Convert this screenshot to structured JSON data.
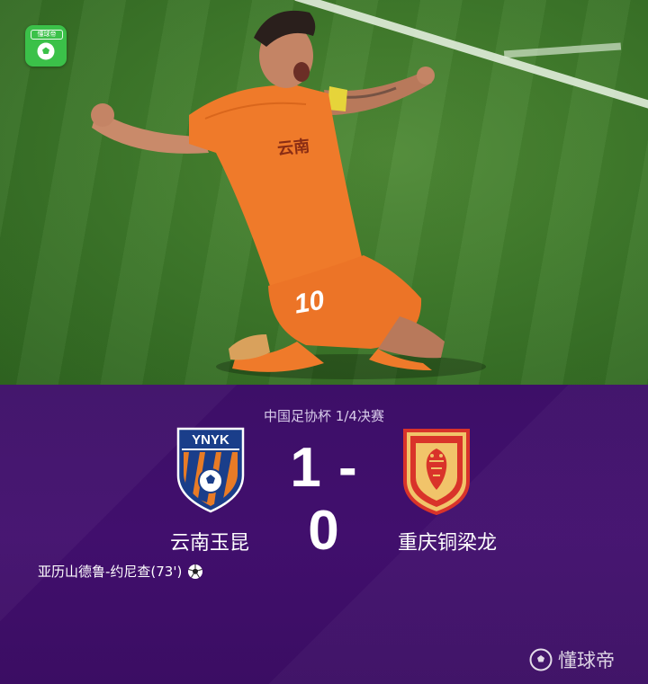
{
  "app_badge": {
    "label": "懂球帝",
    "icon": "soccer-ball-icon",
    "color": "#3bc149"
  },
  "player_jersey": {
    "number": "10",
    "chest_text": "云南"
  },
  "match": {
    "competition": "中国足协杯 1/4决赛",
    "home_team": {
      "name": "云南玉昆",
      "crest_text": "YNYK",
      "crest_colors": [
        "#1a3e8a",
        "#e87b26"
      ]
    },
    "away_team": {
      "name": "重庆铜梁龙",
      "crest_colors": [
        "#d9332a",
        "#f1c46a"
      ]
    },
    "home_score": "1",
    "separator": "-",
    "away_score": "0",
    "scorer": {
      "text": "亚历山德鲁-约尼查(73')",
      "icon": "soccer-ball-icon"
    }
  },
  "watermark": {
    "text": "懂球帝",
    "icon": "soccer-ball-icon"
  },
  "colors": {
    "board_background": "#3d0f68",
    "jersey": "#ef7a2a",
    "pitch": "#3f7a2b"
  }
}
